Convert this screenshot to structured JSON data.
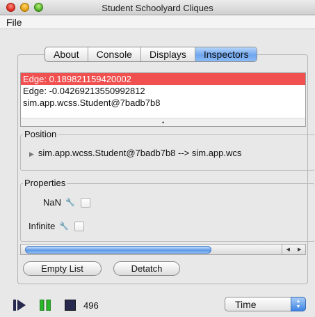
{
  "window": {
    "title": "Student Schoolyard Cliques"
  },
  "menu": {
    "file": "File"
  },
  "tabs": [
    "About",
    "Console",
    "Displays",
    "Inspectors"
  ],
  "active_tab": "Inspectors",
  "inspector_list": [
    "Edge: 0.189821159420002",
    "Edge: -0.04269213550992812",
    "sim.app.wcss.Student@7badb7b8"
  ],
  "selected_index": 0,
  "position": {
    "label": "Position",
    "value": "sim.app.wcss.Student@7badb7b8 --> sim.app.wcs"
  },
  "properties": {
    "label": "Properties",
    "items": [
      {
        "name": "NaN",
        "checked": false
      },
      {
        "name": "Infinite",
        "checked": false
      }
    ]
  },
  "buttons": {
    "empty_list": "Empty List",
    "detach": "Detatch"
  },
  "controls": {
    "steps": "496",
    "time_select": "Time"
  },
  "icons": {
    "play": "play-icon",
    "pause": "pause-icon",
    "stop": "stop-icon",
    "wrench": "wrench-icon"
  },
  "colors": {
    "selected_row": "#f0504f",
    "active_tab": "#6fa6ef",
    "pause": "#2db52d",
    "stop": "#26284e"
  }
}
